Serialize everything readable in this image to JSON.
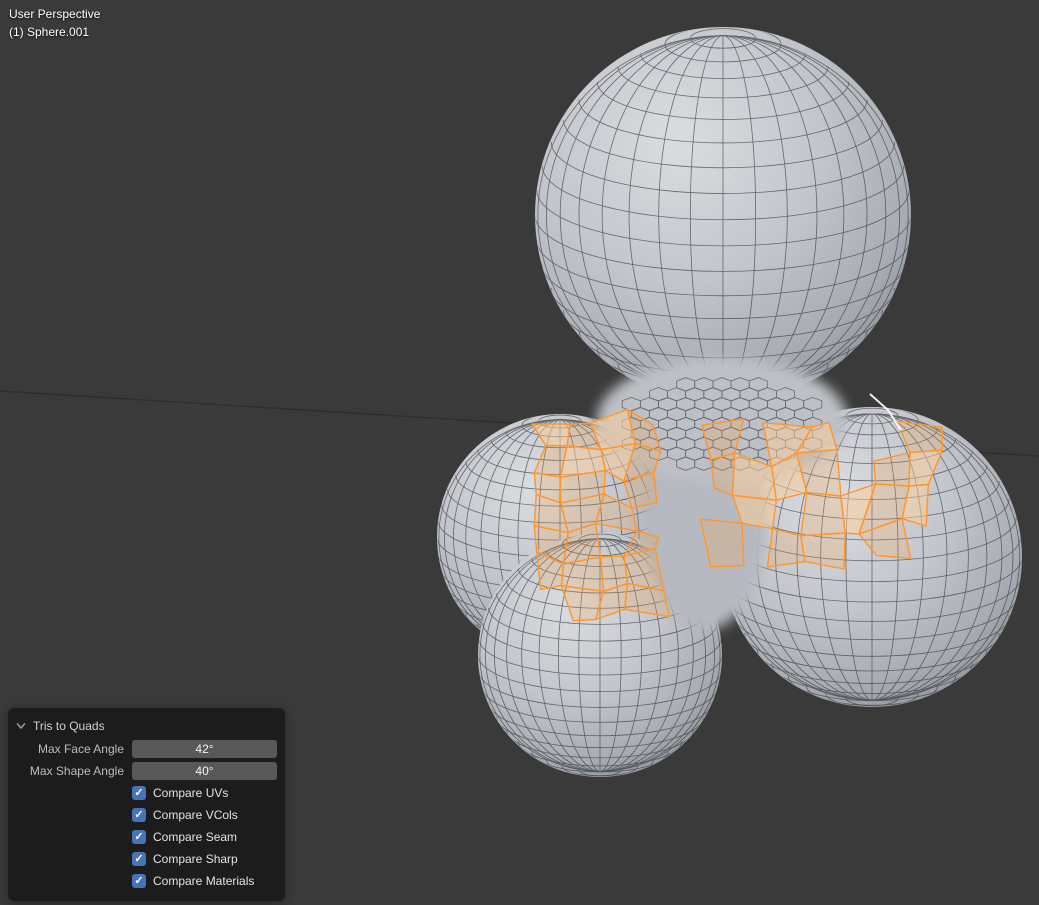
{
  "viewport_overlay": {
    "perspective_label": "User Perspective",
    "object_label": "(1) Sphere.001"
  },
  "panel": {
    "title": "Tris to Quads",
    "fields": [
      {
        "label": "Max Face Angle",
        "value": "42°"
      },
      {
        "label": "Max Shape Angle",
        "value": "40°"
      }
    ],
    "checkboxes": [
      {
        "label": "Compare UVs",
        "checked": true
      },
      {
        "label": "Compare VCols",
        "checked": true
      },
      {
        "label": "Compare Seam",
        "checked": true
      },
      {
        "label": "Compare Sharp",
        "checked": true
      },
      {
        "label": "Compare Materials",
        "checked": true
      }
    ]
  },
  "colors": {
    "accent": "#4773b8",
    "selection": "#ff962b",
    "background": "#3a3a3a",
    "mesh_base": "#c2c6cb",
    "wireframe": "#2f3237"
  }
}
